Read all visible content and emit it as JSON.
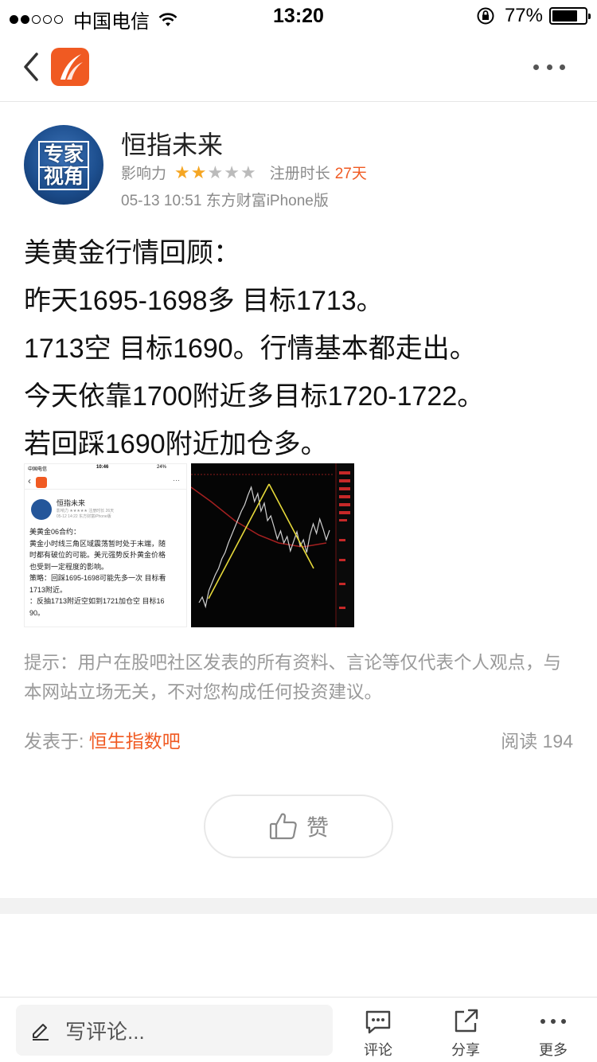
{
  "status_bar": {
    "carrier": "中国电信",
    "time": "13:20",
    "battery": "77%",
    "battery_level": 0.77,
    "signal_bars": 2
  },
  "nav": {
    "back_icon": "chevron-left-icon",
    "app_icon": "eastmoney-logo-icon",
    "more_icon": "more-dots-icon"
  },
  "author": {
    "avatar_line1": "专家",
    "avatar_line2": "视角",
    "name": "恒指未来",
    "influence_label": "影响力",
    "stars_rating": 2,
    "stars_total": 5,
    "register_label": "注册时长",
    "register_days": "27天",
    "post_info": "05-13 10:51 东方财富iPhone版"
  },
  "content": {
    "lines": [
      "美黄金行情回顾：",
      "昨天1695-1698多 目标1713。",
      "1713空 目标1690。行情基本都走出。",
      "今天依靠1700附近多目标1720-1722。",
      "若回踩1690附近加仓多。"
    ]
  },
  "thumb1": {
    "carrier": "中国电信",
    "time": "10:46",
    "battery": "24%",
    "name": "恒指未来",
    "meta": "影响力 ★★★★★ 注册时长 26天",
    "meta2": "05-12 14:22 东方财富iPhone版",
    "lines": [
      "美黄金06合约：",
      "黄金小时线三角区域震荡暂时处于末端，随",
      "时都有破位的可能。美元强势反扑黄金价格",
      "也受到一定程度的影响。",
      "策略：回踩1695-1698可能先多一次 目标看",
      "1713附近。",
      "：反抽1713附近空如到1721加仓空 目标16",
      "90。"
    ]
  },
  "disclaimer": "提示：用户在股吧社区发表的所有资料、言论等仅代表个人观点，与本网站立场无关，不对您构成任何投资建议。",
  "posted": {
    "label": "发表于:",
    "bar_name": "恒生指数吧"
  },
  "reads": {
    "label": "阅读",
    "count": "194"
  },
  "like": {
    "label": "赞",
    "icon": "thumbs-up-icon"
  },
  "bottom": {
    "comment_placeholder": "写评论...",
    "comment_icon": "pencil-icon",
    "tools": [
      {
        "label": "评论",
        "icon": "comment-bubble-icon"
      },
      {
        "label": "分享",
        "icon": "share-icon"
      },
      {
        "label": "更多",
        "icon": "more-dots-icon"
      }
    ]
  }
}
